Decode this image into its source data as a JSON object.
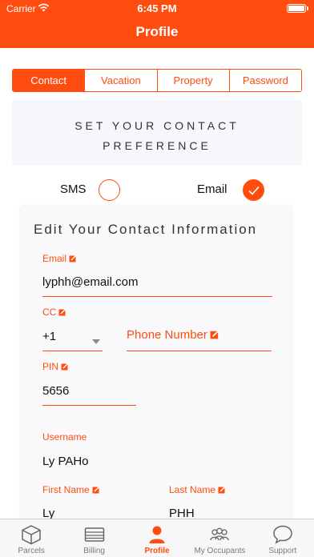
{
  "status_bar": {
    "carrier": "Carrier",
    "time": "6:45 PM"
  },
  "nav": {
    "title": "Profile"
  },
  "segments": [
    {
      "label": "Contact",
      "active": true
    },
    {
      "label": "Vacation",
      "active": false
    },
    {
      "label": "Property",
      "active": false
    },
    {
      "label": "Password",
      "active": false
    }
  ],
  "preference": {
    "title": "SET YOUR CONTACT PREFERENCE",
    "options": [
      {
        "label": "SMS",
        "checked": false
      },
      {
        "label": "Email",
        "checked": true
      }
    ]
  },
  "contact_info": {
    "title": "Edit Your Contact Information",
    "email": {
      "label": "Email",
      "value": "lyphh@email.com"
    },
    "cc": {
      "label": "CC",
      "value": "+1"
    },
    "phone": {
      "placeholder": "Phone Number"
    },
    "pin": {
      "label": "PIN",
      "value": "5656"
    },
    "username": {
      "label": "Username",
      "value": "Ly PAHo"
    },
    "first_name": {
      "label": "First Name",
      "value": "Ly"
    },
    "last_name": {
      "label": "Last Name",
      "value": "PHH"
    }
  },
  "tabs": [
    {
      "label": "Parcels",
      "icon": "box-icon",
      "active": false
    },
    {
      "label": "Billing",
      "icon": "billing-icon",
      "active": false
    },
    {
      "label": "Profile",
      "icon": "person-icon",
      "active": true
    },
    {
      "label": "My Occupants",
      "icon": "occupants-icon",
      "active": false
    },
    {
      "label": "Support",
      "icon": "chat-icon",
      "active": false
    }
  ],
  "colors": {
    "accent": "#ff4d0f",
    "card": "#f7f7fb",
    "tabbar": "#f7f7f7"
  }
}
